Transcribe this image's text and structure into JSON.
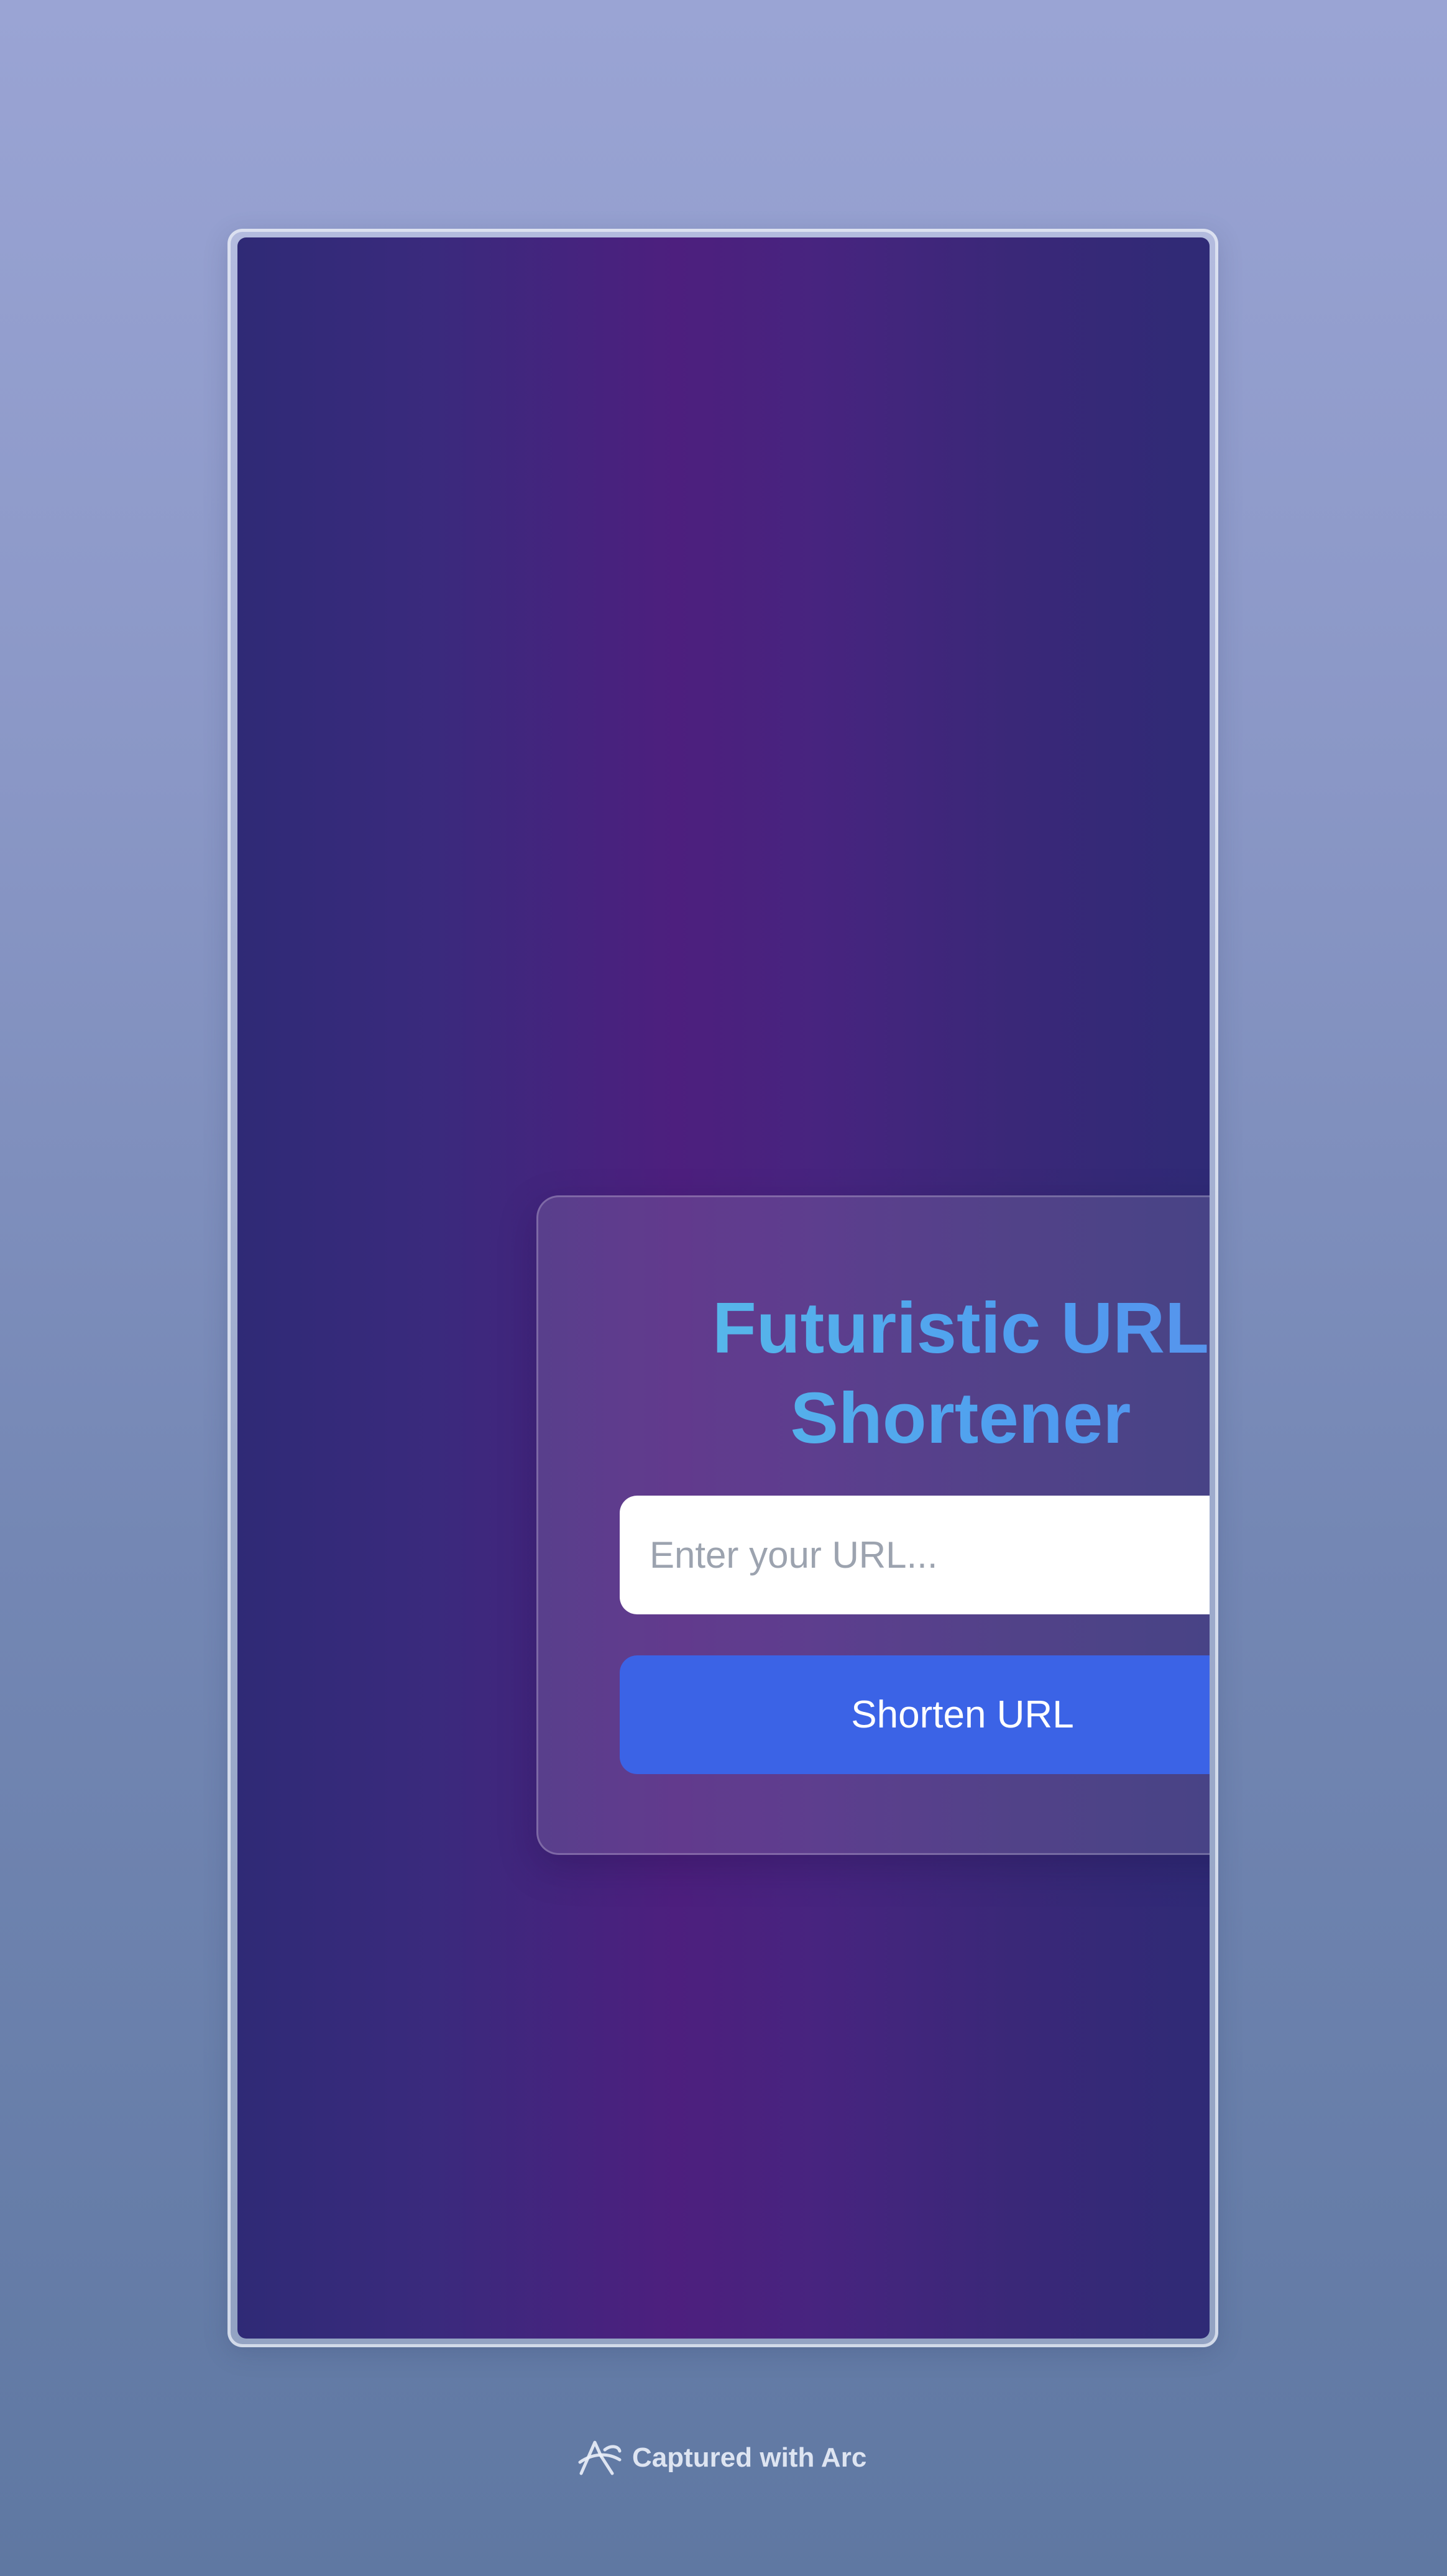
{
  "app": {
    "title": "Futuristic URL Shortener",
    "input_placeholder": "Enter your URL...",
    "input_value": "",
    "button_label": "Shorten URL"
  },
  "footer": {
    "text": "Captured with Arc",
    "icon": "arc-logo-icon"
  },
  "colors": {
    "title_gradient_start": "#5ac4e6",
    "title_gradient_end": "#5f8ce8",
    "button_background": "#3b63e6",
    "input_background": "#ffffff",
    "app_background_center": "#4d1f7e",
    "app_background_edge": "#2f2a76"
  }
}
